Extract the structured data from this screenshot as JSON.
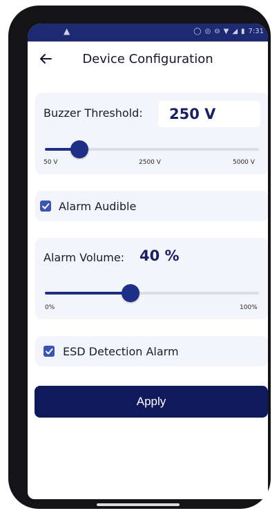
{
  "status_bar": {
    "time": "7:31",
    "left_icon": "alert-triangle-icon",
    "right_icons": [
      "circle-icon",
      "vibrate-icon",
      "dnd-icon",
      "wifi-icon",
      "signal-icon",
      "battery-icon"
    ]
  },
  "header": {
    "title": "Device Configuration",
    "back_icon": "arrow-left-icon"
  },
  "buzzer": {
    "label": "Buzzer Threshold:",
    "value": "250 V",
    "slider": {
      "min": 50,
      "max": 5000,
      "value": 250,
      "unit": "V"
    },
    "ticks": [
      "50 V",
      "2500 V",
      "5000 V"
    ]
  },
  "alarm_audible": {
    "label": "Alarm Audible",
    "checked": true
  },
  "volume": {
    "label": "Alarm Volume:",
    "value": "40 %",
    "slider": {
      "min": 0,
      "max": 100,
      "value": 40,
      "unit": "%"
    },
    "ticks": [
      "0%",
      "100%"
    ]
  },
  "esd": {
    "label": "ESD Detection Alarm",
    "checked": true
  },
  "apply_label": "Apply",
  "colors": {
    "primary": "#1f2f86",
    "button": "#0f1a5c",
    "status_bar": "#1d2a72",
    "card": "#f4f5fa",
    "checkbox": "#3a54b0"
  }
}
